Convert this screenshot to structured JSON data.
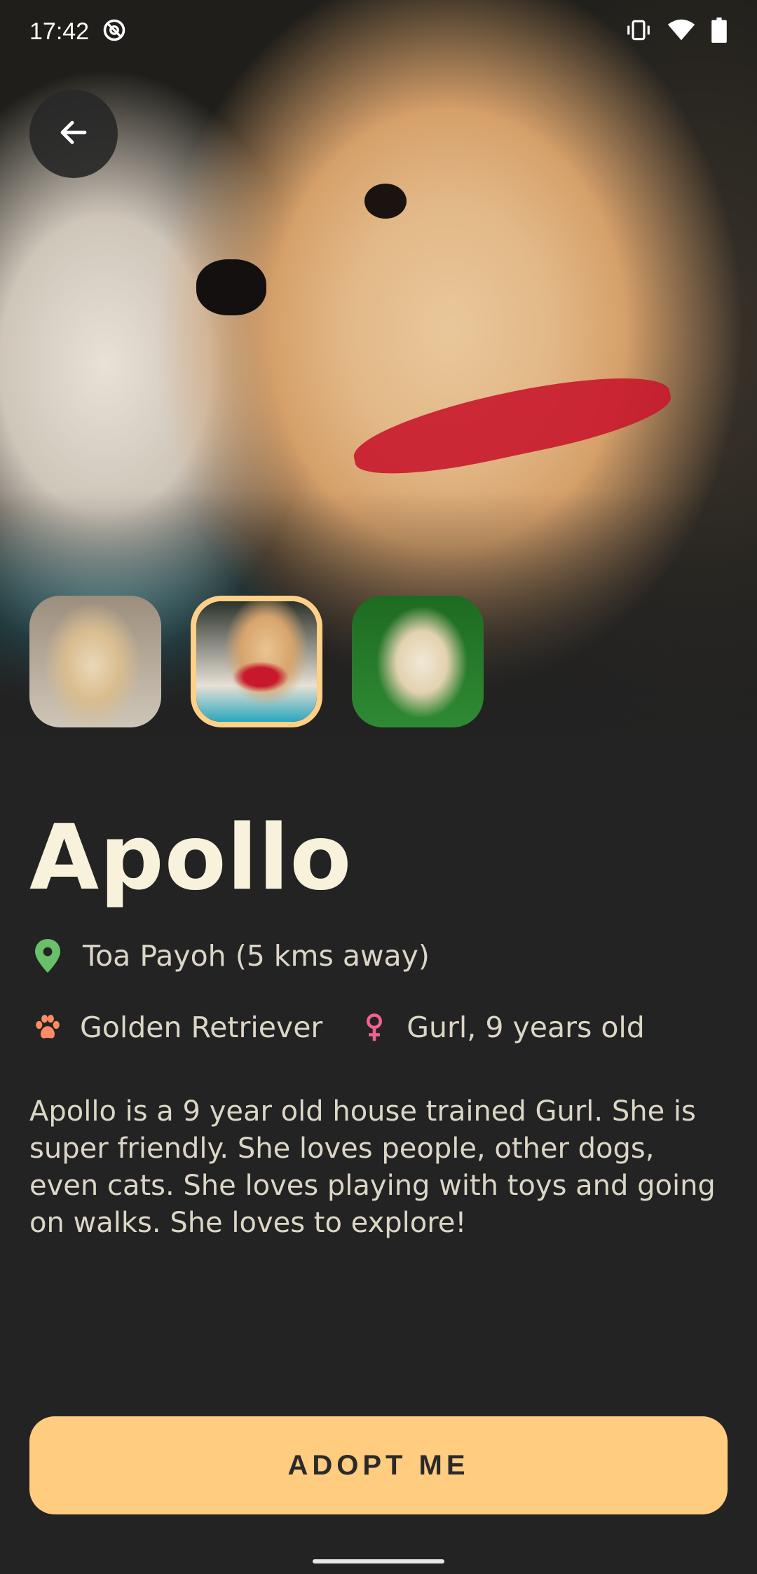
{
  "status_bar": {
    "time": "17:42",
    "icons": [
      "at-sign-icon",
      "vibrate-icon",
      "wifi-icon",
      "battery-icon"
    ]
  },
  "header": {
    "back_icon": "arrow-left-icon"
  },
  "gallery": {
    "thumbnails": [
      {
        "alt": "puppy-lying"
      },
      {
        "alt": "puppy-red-collar",
        "selected": true
      },
      {
        "alt": "puppy-on-grass"
      }
    ],
    "selected_border_color": "#ffd087"
  },
  "pet": {
    "name": "Apollo",
    "location": "Toa Payoh (5 kms away)",
    "breed": "Golden Retriever",
    "gender_age": "Gurl, 9 years old",
    "description": "Apollo is a 9 year old house trained Gurl. She is super friendly. She loves people, other dogs, even cats. She loves playing with toys and going on walks. She loves to explore!"
  },
  "colors": {
    "accent": "#ffcc80",
    "location_icon": "#6abf69",
    "paw_icon": "#ff8a65",
    "gender_icon": "#f06292",
    "background": "#232323"
  },
  "actions": {
    "adopt_label": "ADOPT ME"
  }
}
